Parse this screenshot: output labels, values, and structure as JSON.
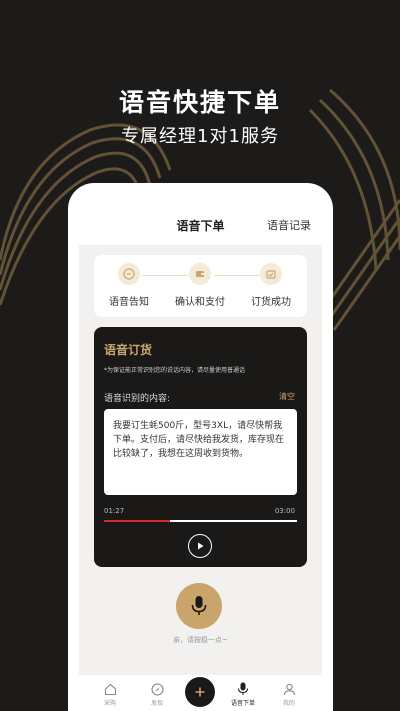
{
  "promo": {
    "title": "语音快捷下单",
    "subtitle": "专属经理1对1服务"
  },
  "header": {
    "title": "语音下单",
    "link": "语音记录"
  },
  "steps": [
    {
      "label": "语音告知",
      "icon": "chat-icon"
    },
    {
      "label": "确认和支付",
      "icon": "wallet-icon"
    },
    {
      "label": "订货成功",
      "icon": "check-bag-icon"
    }
  ],
  "voice_order": {
    "title": "语音订货",
    "note": "*为保证能正常识别您的说话内容，请尽量使用普通话",
    "label": "语音识别的内容:",
    "clear": "清空",
    "text": "我要订生蚝500斤，型号3XL，请尽快帮我下单。支付后，请尽快给我发货，库存现在比较缺了，我想在这周收到货物。",
    "time_current": "01:27",
    "time_total": "03:00",
    "progress": 0.34
  },
  "mic": {
    "hint": "亲，请按稳一点~"
  },
  "tabbar": {
    "items": [
      {
        "label": "采购",
        "icon": "home-icon"
      },
      {
        "label": "发现",
        "icon": "compass-icon"
      },
      {
        "label": "",
        "icon": "plus-icon"
      },
      {
        "label": "语音下单",
        "icon": "microphone-icon"
      },
      {
        "label": "我的",
        "icon": "user-icon"
      }
    ]
  },
  "colors": {
    "background": "#1c1b1a",
    "accent_gold": "#c9a56c",
    "card_dark": "#1a1918",
    "progress_red": "#d22a2a"
  }
}
